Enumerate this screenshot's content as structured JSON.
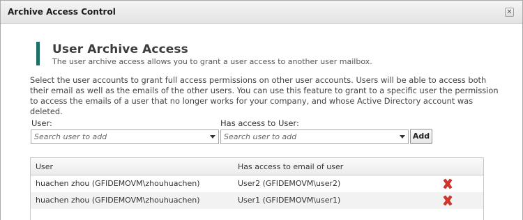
{
  "window": {
    "title": "Archive Access Control"
  },
  "section": {
    "heading": "User Archive Access",
    "subheading": "The user archive access allows you to grant a user access to another user mailbox.",
    "description": "Select the user accounts to grant full access permissions on other user accounts. Users will be able to access both their email as well as the emails of the other users. You can use this feature to grant to a specific user the permission to access the emails of a user that no longer works for your company, and whose Active Directory account was deleted."
  },
  "form": {
    "user_label": "User:",
    "user_placeholder": "Search user to add",
    "access_label": "Has access to User:",
    "access_placeholder": "Search user to add",
    "add_label": "Add"
  },
  "table": {
    "columns": [
      "User",
      "Has access to email of user"
    ],
    "rows": [
      {
        "user": "huachen zhou (GFIDEMOVM\\zhouhuachen)",
        "access": "User2 (GFIDEMOVM\\user2)"
      },
      {
        "user": "huachen zhou (GFIDEMOVM\\zhouhuachen)",
        "access": "User1 (GFIDEMOVM\\user1)"
      }
    ]
  },
  "colors": {
    "accent": "#1e6f66",
    "delete": "#d9342b"
  },
  "icons": {
    "close": "close-icon",
    "delete": "delete-x-icon",
    "dropdown": "chevron-down-icon"
  }
}
